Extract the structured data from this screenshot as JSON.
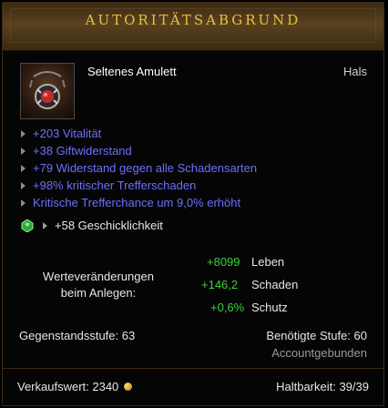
{
  "item": {
    "name": "AUTORITÄTSABGRUND",
    "type": "Seltenes Amulett",
    "slot": "Hals",
    "icon": "amulet-icon",
    "accent_color": "#e8c23a"
  },
  "affixes": [
    "+203 Vitalität",
    "+38 Giftwiderstand",
    "+79 Widerstand gegen alle Schadensarten",
    "+98% kritischer Trefferschaden",
    "Kritische Trefferchance um 9,0% erhöht"
  ],
  "affix_color": "#6e6eff",
  "socket": {
    "icon": "emerald-gem-icon",
    "text": "+58 Geschicklichkeit"
  },
  "equip_changes": {
    "label": "Werteveränderungen beim Anlegen:",
    "stats": [
      {
        "value": "+8099",
        "name": "Leben"
      },
      {
        "value": "+146,2",
        "name": "Schaden"
      },
      {
        "value": "+0,6%",
        "name": "Schutz"
      }
    ],
    "positive_color": "#3ccf3c"
  },
  "requirements": {
    "item_level": "Gegenstandsstufe: 63",
    "required_level": "Benötigte Stufe: 60",
    "binding": "Accountgebunden"
  },
  "footer": {
    "sell_value": "Verkaufswert: 2340",
    "coin_icon": "gold-coin-icon",
    "durability": "Haltbarkeit: 39/39"
  }
}
